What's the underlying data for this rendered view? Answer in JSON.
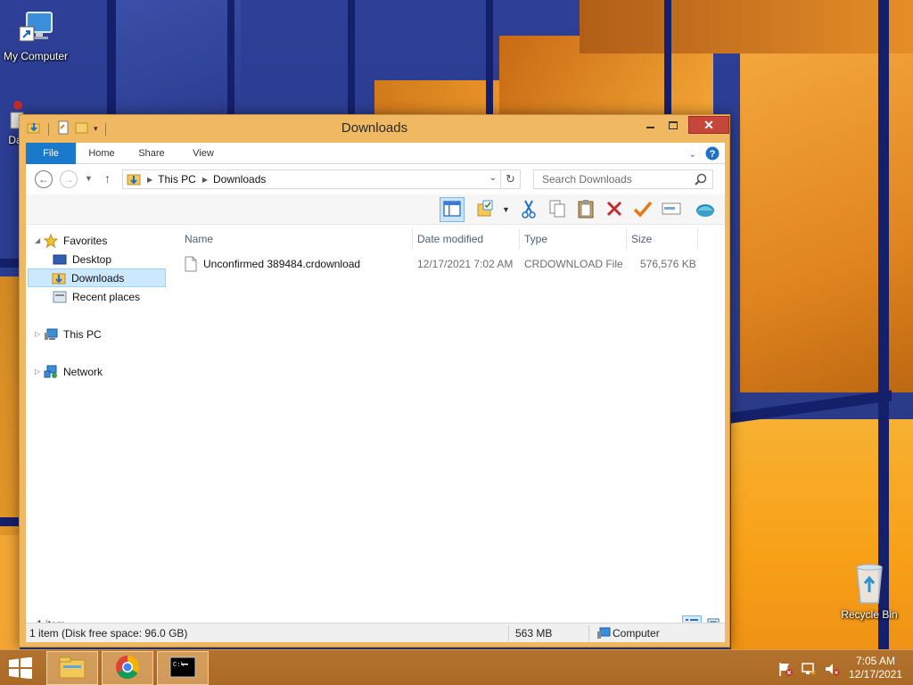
{
  "desktop": {
    "icons": [
      {
        "label": "My Computer"
      },
      {
        "label": "Dat"
      },
      {
        "label": "Recycle Bin"
      }
    ]
  },
  "window": {
    "title": "Downloads",
    "ribbon_tabs": [
      "File",
      "Home",
      "Share",
      "View"
    ],
    "nav": {
      "path": [
        "This PC",
        "Downloads"
      ]
    },
    "search": {
      "placeholder": "Search Downloads"
    },
    "toolbar_icons": [
      "preview-pane-icon",
      "folder-options-icon",
      "cut-icon",
      "copy-icon",
      "paste-icon",
      "delete-icon",
      "checkmark-icon",
      "rename-icon",
      "globe-icon"
    ],
    "sidebar": {
      "favorites": "Favorites",
      "items": [
        {
          "label": "Desktop"
        },
        {
          "label": "Downloads"
        },
        {
          "label": "Recent places"
        }
      ],
      "this_pc": "This PC",
      "network": "Network"
    },
    "columns": [
      "Name",
      "Date modified",
      "Type",
      "Size"
    ],
    "files": [
      {
        "name": "Unconfirmed 389484.crdownload",
        "date": "12/17/2021 7:02 AM",
        "type": "CRDOWNLOAD File",
        "size": "576,576 KB"
      }
    ],
    "item_count": "1 item",
    "status": {
      "left": "1 item (Disk free space: 96.0 GB)",
      "middle": "563 MB",
      "right": "Computer"
    }
  },
  "taskbar": {
    "apps": [
      "file-explorer",
      "chrome",
      "command-prompt"
    ],
    "clock": {
      "time": "7:05 AM",
      "date": "12/17/2021"
    }
  }
}
